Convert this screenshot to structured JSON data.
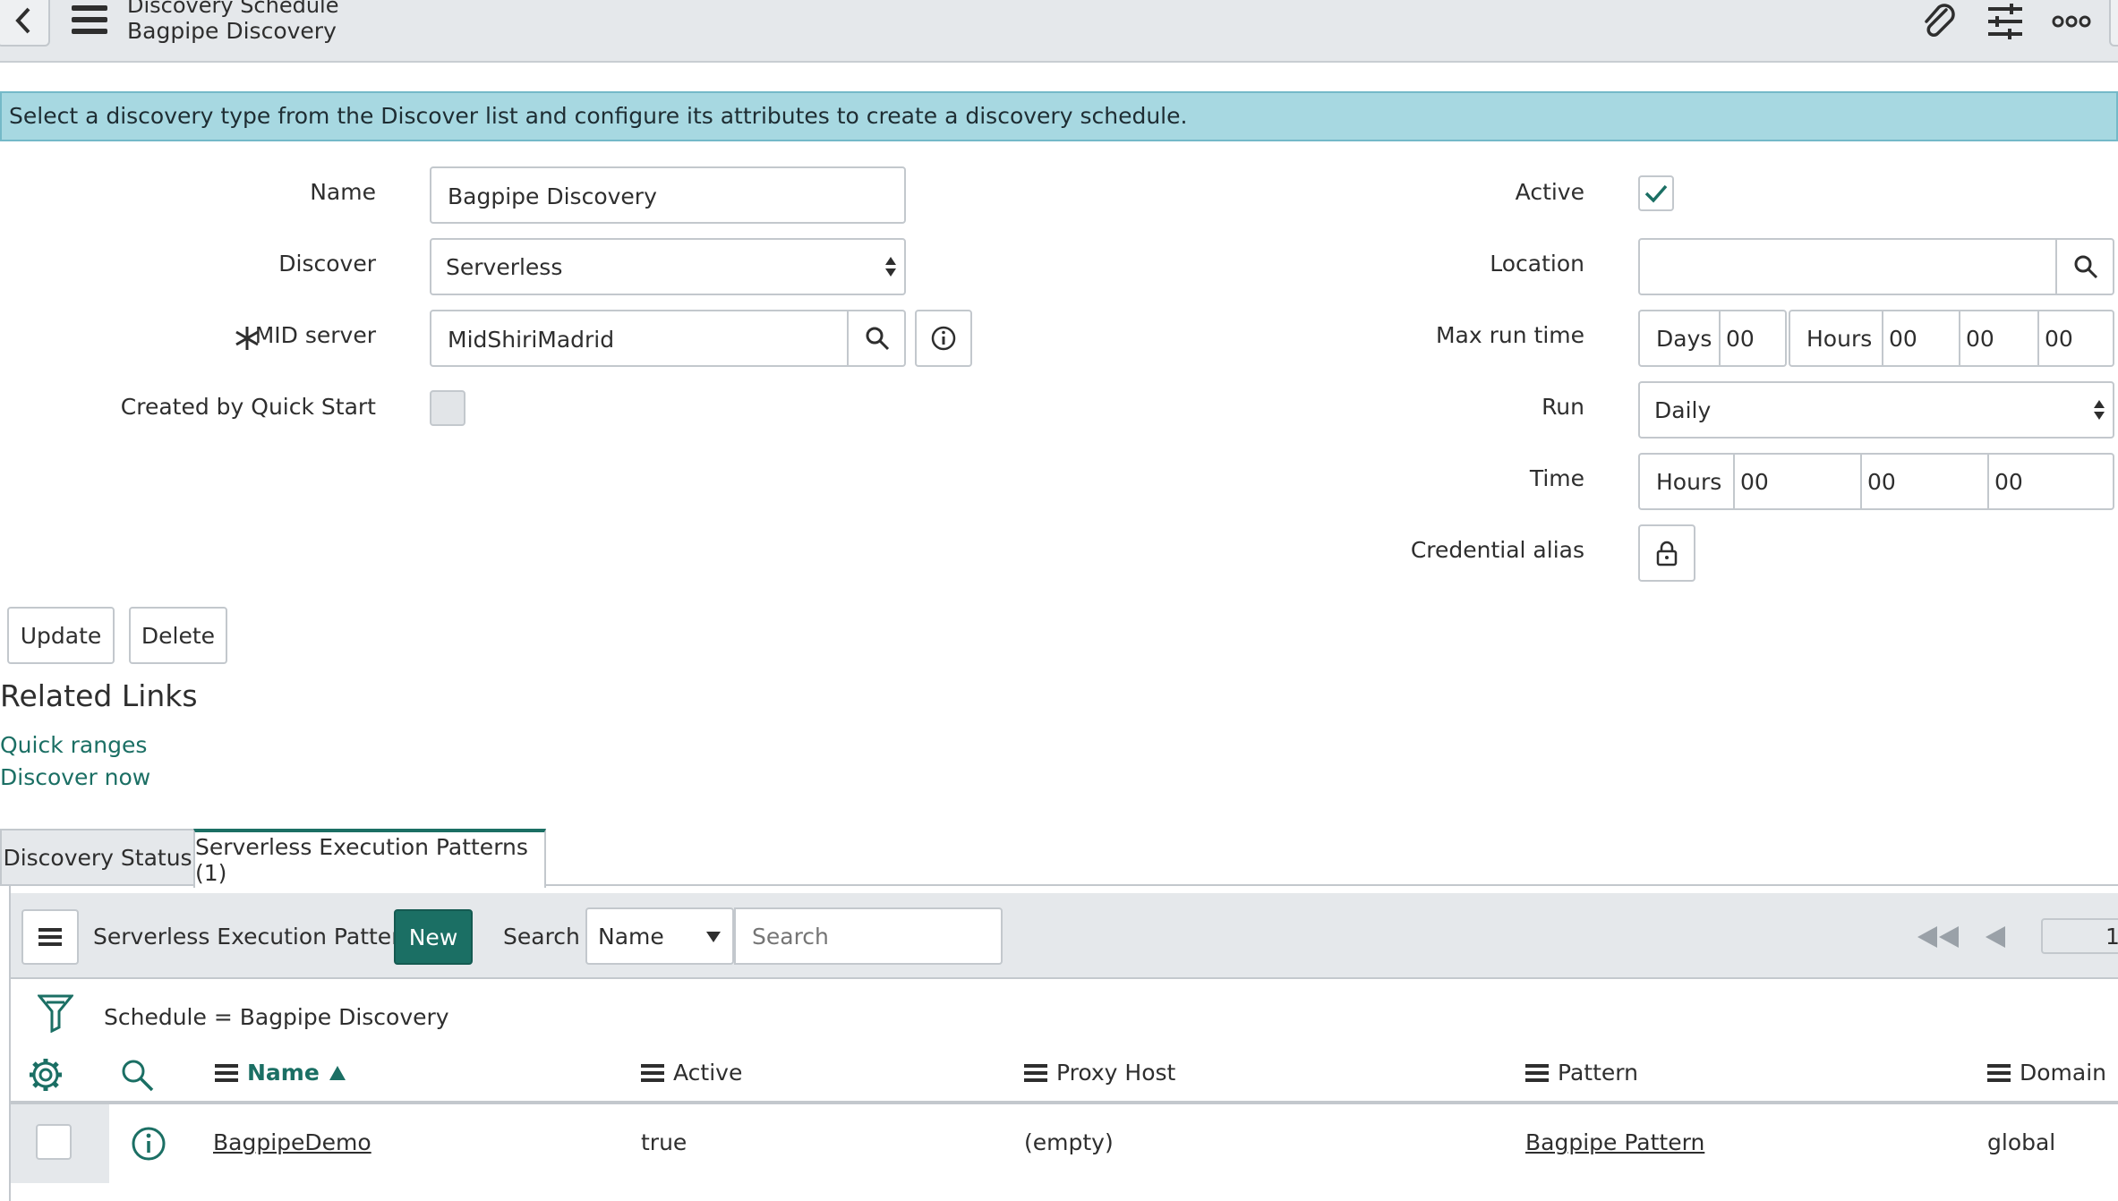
{
  "header": {
    "title": "Discovery Schedule",
    "subtitle": "Bagpipe Discovery",
    "icons": [
      "back-icon",
      "menu-icon",
      "paperclip-icon",
      "settings-sliders-icon",
      "more-icon"
    ]
  },
  "banner": {
    "text": "Select a discovery type from the Discover list and configure its attributes to create a discovery schedule."
  },
  "form": {
    "name_label": "Name",
    "name_value": "Bagpipe Discovery",
    "discover_label": "Discover",
    "discover_value": "Serverless",
    "mid_server_label": "MID server",
    "mid_server_value": "MidShiriMadrid",
    "quick_start_label": "Created by Quick Start",
    "active_label": "Active",
    "active_checked": true,
    "location_label": "Location",
    "location_value": "",
    "max_run_time_label": "Max run time",
    "max_run": {
      "days_label": "Days",
      "days_value": "00",
      "hours_label": "Hours",
      "hours_value": "00",
      "minutes_value": "00",
      "seconds_value": "00"
    },
    "run_label": "Run",
    "run_value": "Daily",
    "time_label": "Time",
    "time": {
      "hours_label": "Hours",
      "hours_value": "00",
      "minutes_value": "00",
      "seconds_value": "00"
    },
    "credential_alias_label": "Credential alias"
  },
  "actions": {
    "update": "Update",
    "delete": "Delete"
  },
  "related_links": {
    "heading": "Related Links",
    "links": [
      "Quick ranges",
      "Discover now"
    ]
  },
  "tabs": [
    {
      "label": "Discovery Status"
    },
    {
      "label": "Serverless Execution Patterns (1)"
    }
  ],
  "list": {
    "title": "Serverless Execution Patterns",
    "new_button": "New",
    "search_label": "Search",
    "search_field": "Name",
    "search_placeholder": "Search",
    "page_number": "1",
    "filter_text": "Schedule = Bagpipe Discovery",
    "columns": [
      "Name",
      "Active",
      "Proxy Host",
      "Pattern",
      "Domain"
    ],
    "rows": [
      {
        "name": "BagpipeDemo",
        "active": "true",
        "proxy_host": "(empty)",
        "pattern": "Bagpipe Pattern",
        "domain": "global"
      }
    ]
  },
  "colors": {
    "accent": "#1b6f64",
    "banner_bg": "#a7d8e1",
    "header_bg": "#e5e8eb"
  }
}
